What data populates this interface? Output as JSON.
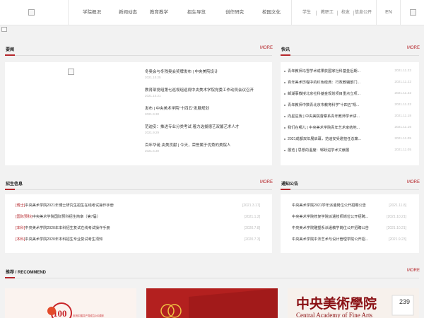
{
  "nav": {
    "items": [
      "学院概况",
      "新闻动态",
      "教育教学",
      "招生导览",
      "创作研究",
      "校园文化"
    ],
    "util": [
      "学生",
      "教职工",
      "校友",
      "信息公开"
    ],
    "lang": "EN"
  },
  "news": {
    "title": "要闻",
    "more": "MORE",
    "items": [
      {
        "title": "冬奥会与冬残奥会奖牌发布 | 中央美院设计",
        "date": "2021.10.25"
      },
      {
        "title": "教育部党组第七巡视组巡视中央美术学院党委工作动员会议召开",
        "date": "2021.10.21"
      },
      {
        "title": "发布 | 中央美术学院\"十四五\"发展规划",
        "date": "2021.9.30"
      },
      {
        "title": "范迪安：推进专业分类考试 着力选拔德艺双馨艺术人才",
        "date": "2021.9.29"
      },
      {
        "title": "百年华诞 央美贡献 | 今天，荣誉属于优秀的美院人",
        "date": "2021.6.30"
      }
    ]
  },
  "flash": {
    "title": "快讯",
    "more": "MORE",
    "items": [
      {
        "title": "青年教师冯雪学术成果获国家社科基金后期...",
        "date": "2021.11.22"
      },
      {
        "title": "百年美术历程中的红色经典：行政教辅部门...",
        "date": "2021.11.22"
      },
      {
        "title": "邮湖事教授北京社科基金规划项目重点立项...",
        "date": "2021.11.22"
      },
      {
        "title": "青年教师中数青北京市教育科学\"十四五\"规...",
        "date": "2021.11.22"
      },
      {
        "title": "向星驻我 | 中央美院督察系青年教师学术讲...",
        "date": "2021.11.18"
      },
      {
        "title": "我们在哪儿 | 中央美术学院青年艺术家结地...",
        "date": "2021.11.16"
      },
      {
        "title": "2021成都双年展启幕，范迪安受邀担任总策...",
        "date": "2021.11.05"
      },
      {
        "title": "展览 | 思想的温度：邹跃进学术文献展",
        "date": "2021.11.05"
      }
    ]
  },
  "admissions": {
    "title": "招生信息",
    "more": "MORE",
    "items": [
      {
        "tag": "[博士]",
        "title": "中央美术学院2021年博士研究生招生在线考试操作手册",
        "date": "[2021.3.17]"
      },
      {
        "tag": "[国际预科]",
        "title": "中央美术学院国际预科招生简章（第7届）",
        "date": "[2021.1.2]"
      },
      {
        "tag": "[本科]",
        "title": "中央美术学院2020年本科招生复试在线考试操作手册",
        "date": "[2020.7.8]"
      },
      {
        "tag": "[本科]",
        "title": "中央美术学院2020年本科招生专业复试考生须知",
        "date": "[2020.7.3]"
      }
    ]
  },
  "notices": {
    "title": "通知公告",
    "more": "MORE",
    "items": [
      {
        "title": "中央美术学院2021学年派遣岗位公开招聘公告",
        "date": "[2021.11.8]"
      },
      {
        "title": "中央美术学院修复学院派遣技师岗位公开招聘...",
        "date": "[2021.10.21]"
      },
      {
        "title": "中央美术学院雕塑系派遣教学岗位公开招聘公告",
        "date": "[2021.10.21]"
      },
      {
        "title": "中央美术学院中法艺术与设计管理学院公开招...",
        "date": "[2021.9.23]"
      }
    ]
  },
  "recommend": {
    "title": "推荐 / RECOMMEND",
    "more": "MORE",
    "cards": [
      {
        "caption": "庆祝中国共产党成立100周年"
      },
      {
        "caption": ""
      },
      {
        "caption": "中央美術學院",
        "sub": "Central Academy of Fine Arts",
        "num": "239"
      }
    ]
  },
  "colors": {
    "accent": "#b5262b",
    "bg": "#f2f2f2"
  }
}
